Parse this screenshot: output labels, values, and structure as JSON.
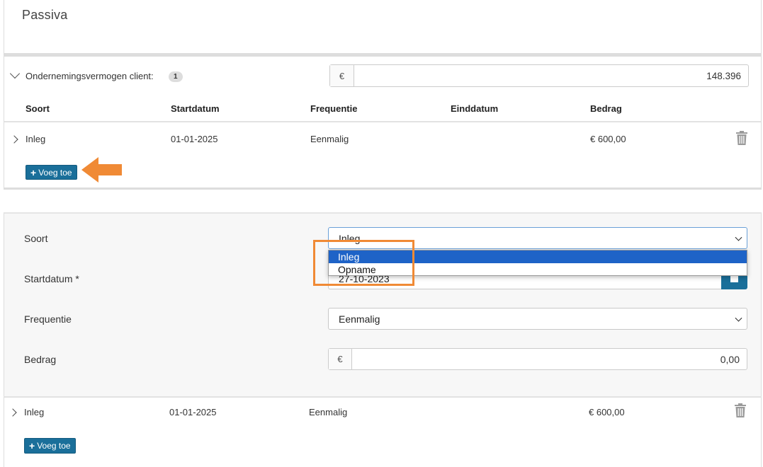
{
  "page": {
    "title": "Passiva"
  },
  "section": {
    "label": "Ondernemingsvermogen client:",
    "count": "1",
    "currency": "€",
    "total": "148.396"
  },
  "table": {
    "headers": [
      "Soort",
      "Startdatum",
      "Frequentie",
      "Einddatum",
      "Bedrag"
    ],
    "row1": {
      "soort": "Inleg",
      "startdatum": "01-01-2025",
      "frequentie": "Eenmalig",
      "einddatum": "",
      "bedrag": "€ 600,00"
    },
    "add_label": "Voeg toe"
  },
  "form": {
    "soort_label": "Soort",
    "soort_value": "Inleg",
    "startdatum_label": "Startdatum *",
    "startdatum_value": "27-10-2023",
    "frequentie_label": "Frequentie",
    "frequentie_value": "Eenmalig",
    "bedrag_label": "Bedrag",
    "bedrag_currency": "€",
    "bedrag_value": "0,00"
  },
  "dropdown": {
    "options": [
      "Inleg",
      "Opname"
    ],
    "selected": "Inleg"
  },
  "bottom": {
    "row": {
      "soort": "Inleg",
      "startdatum": "01-01-2025",
      "frequentie": "Eenmalig",
      "einddatum": "",
      "bedrag": "€ 600,00"
    },
    "add_label": "Voeg toe"
  },
  "colors": {
    "accent": "#1a6f9a",
    "highlight": "#f08a35",
    "select_active": "#1e63c7"
  },
  "icons": [
    "chevron-down-icon",
    "chevron-right-icon",
    "trash-icon",
    "plus-icon",
    "calendar-icon",
    "arrow-left-icon"
  ]
}
